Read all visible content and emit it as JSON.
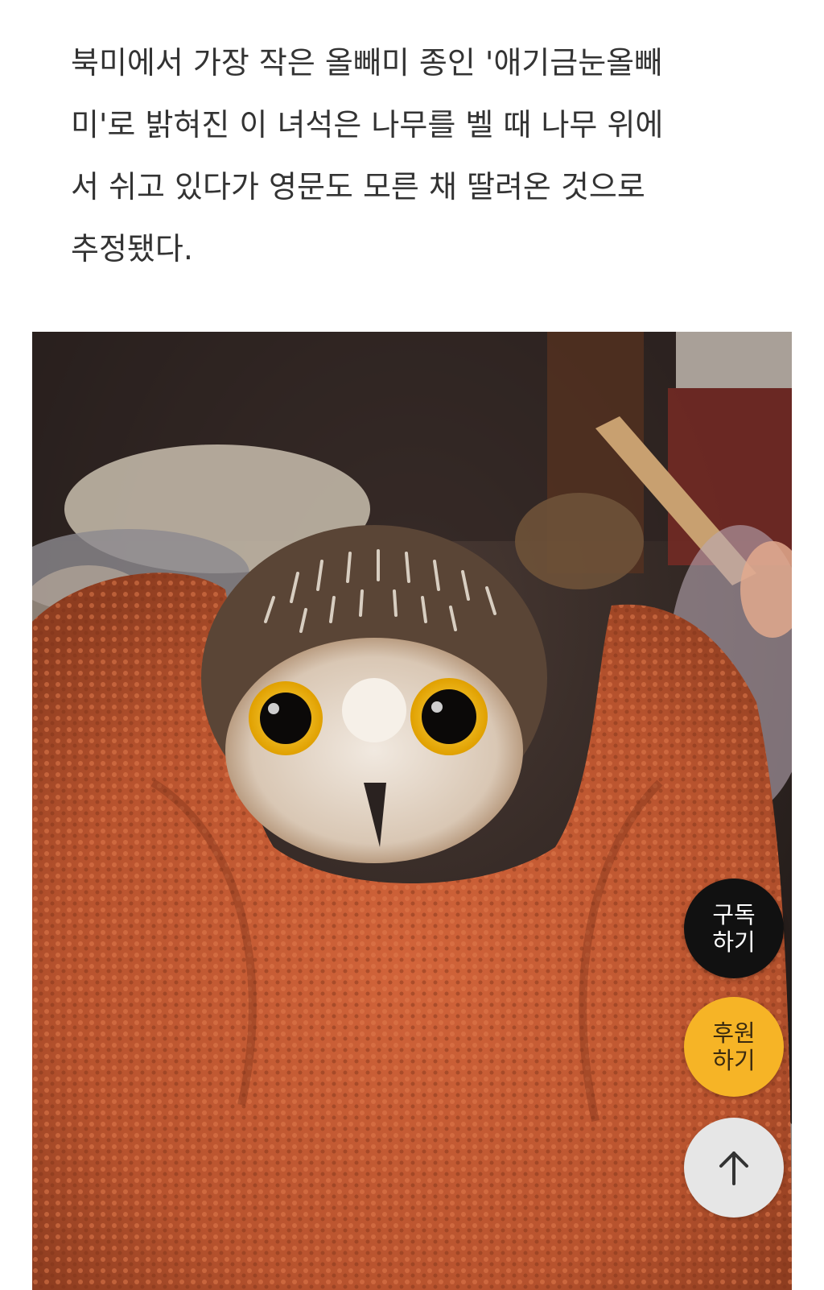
{
  "article": {
    "paragraph": "북미에서 가장 작은 올빼미 종인 '애기금눈올빼\n미'로 밝혀진 이 녀석은 나무를 벨 때 나무 위에\n서 쉬고 있다가 영문도 모른 채 딸려온 것으로\n추정됐다."
  },
  "image": {
    "subject": "saw-whet owl wrapped in orange knit cloth"
  },
  "floating_buttons": {
    "subscribe": {
      "line1": "구독",
      "line2": "하기",
      "color": "#111111"
    },
    "support": {
      "line1": "후원",
      "line2": "하기",
      "color": "#f6b426"
    },
    "scroll_top": {
      "icon": "arrow-up-icon"
    }
  }
}
